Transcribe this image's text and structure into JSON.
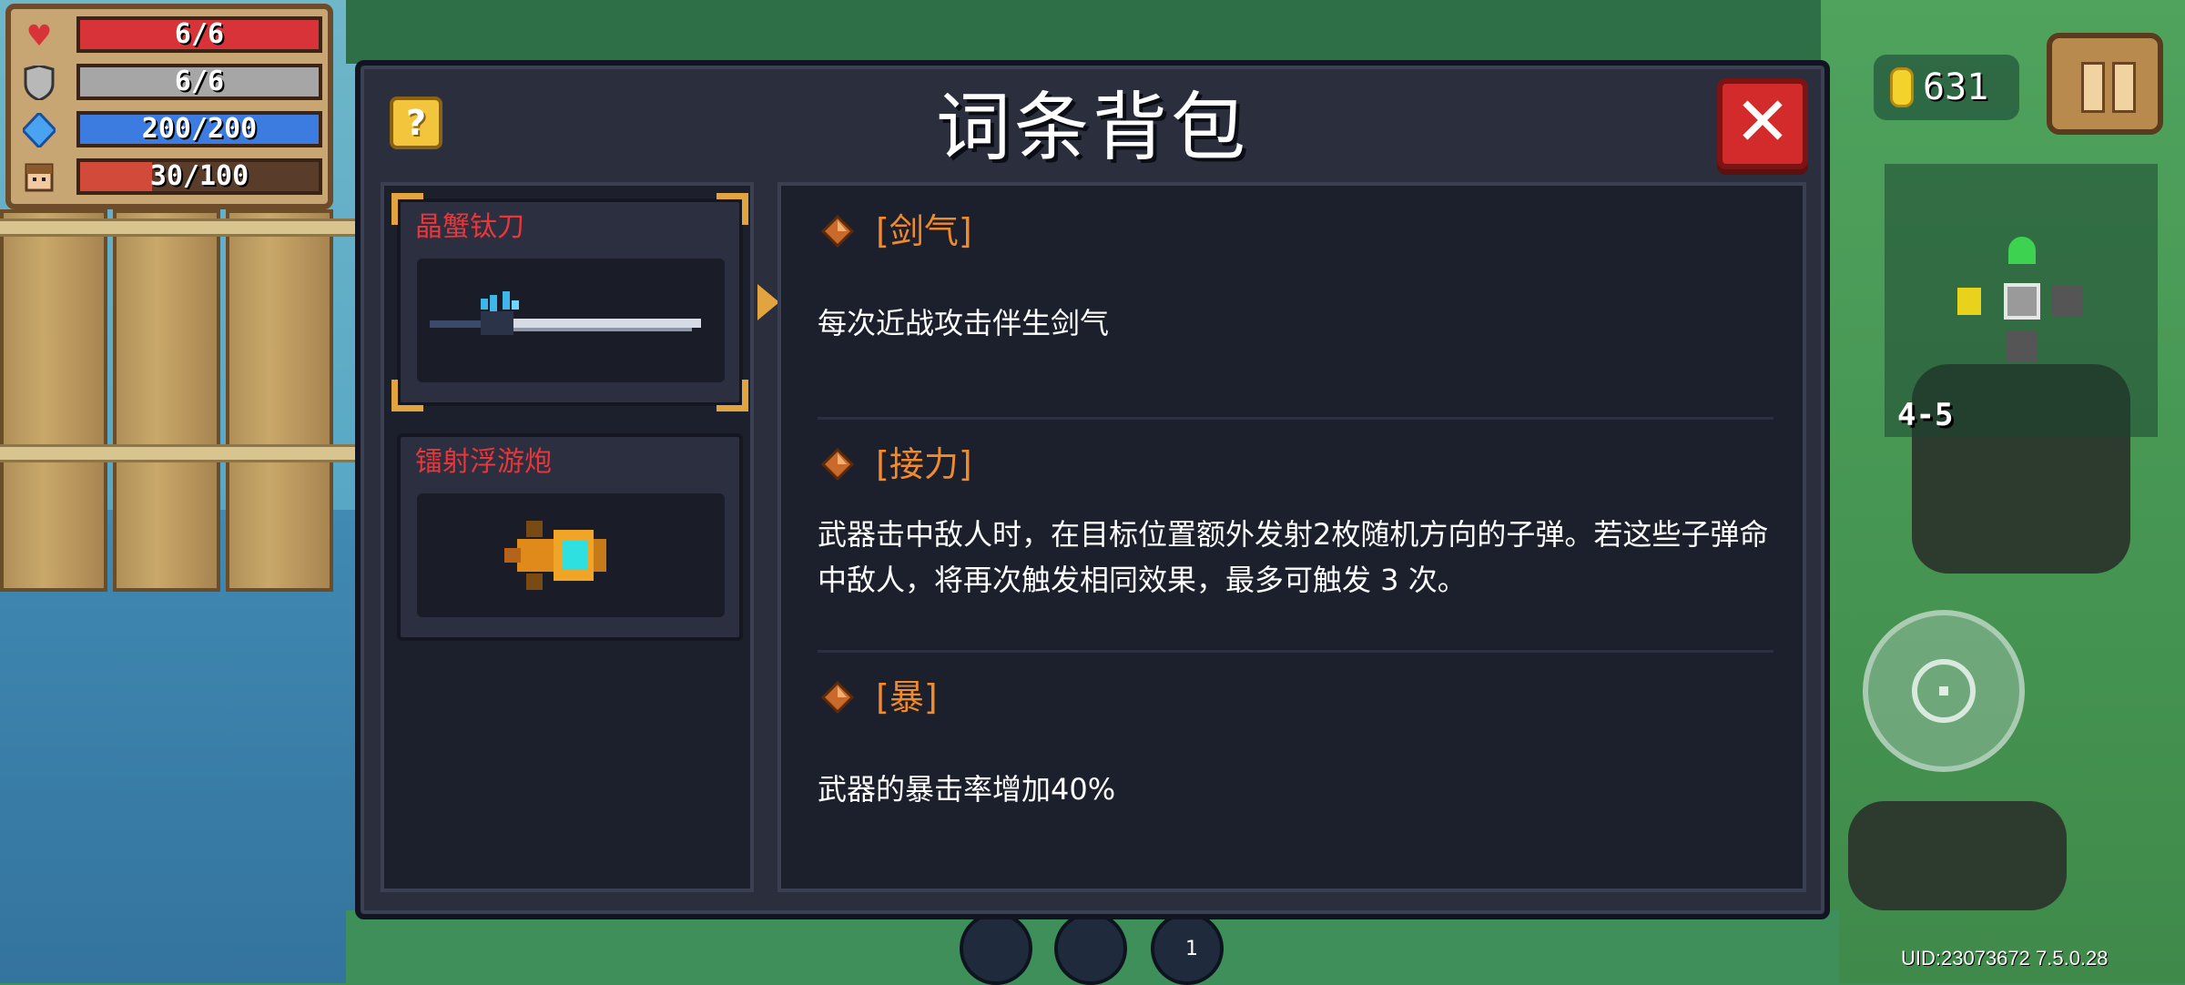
{
  "hud": {
    "hp": "6/6",
    "hp_fill": 1.0,
    "armor": "6/6",
    "armor_fill": 1.0,
    "energy": "200/200",
    "energy_fill": 1.0,
    "exp": "30/100",
    "exp_fill": 0.3,
    "coins": "631",
    "level": "4-5",
    "uid": "UID:23073672 7.5.0.28",
    "skill_count": "1"
  },
  "dialog": {
    "title": "词条背包",
    "help_label": "?",
    "close_label": "✕"
  },
  "weapons": [
    {
      "name": "晶蟹钛刀",
      "selected": true
    },
    {
      "name": "镭射浮游炮",
      "selected": false
    }
  ],
  "entries": [
    {
      "title": "[剑气]",
      "desc": "每次近战攻击伴生剑气"
    },
    {
      "title": "[接力]",
      "desc": "武器击中敌人时，在目标位置额外发射2枚随机方向的子弹。若这些子弹命中敌人，将再次触发相同效果，最多可触发 3 次。"
    },
    {
      "title": "[暴]",
      "desc": "武器的暴击率增加40%"
    }
  ],
  "colors": {
    "hp": "#d9333a",
    "armor": "#a6a6a6",
    "energy": "#3c7be0",
    "exp": "#d14a3a",
    "entry_title": "#f08a2a",
    "weapon_name": "#e8363a"
  },
  "icons": {
    "hp": "heart-icon",
    "armor": "shield-icon",
    "energy": "diamond-icon",
    "exp": "character-head-icon",
    "coin": "coin-icon",
    "entry": "gem-icon"
  }
}
